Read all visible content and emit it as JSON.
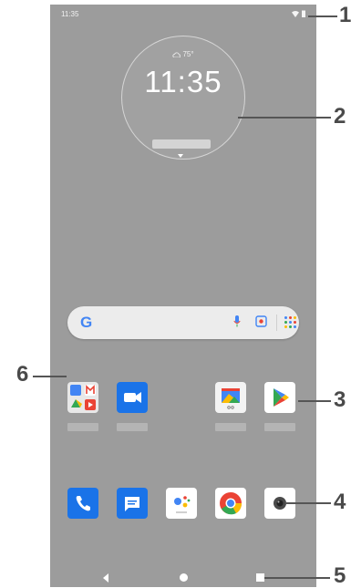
{
  "status_bar": {
    "time": "11:35"
  },
  "clock_widget": {
    "weather": "75°",
    "time": "11:35"
  },
  "search": {
    "logo": "G"
  },
  "colors": {
    "google_blue": "#4285F4",
    "google_red": "#EA4335",
    "google_yellow": "#FBBC05",
    "google_green": "#34A853",
    "wallpaper": "#9c9c9c"
  },
  "apps_row": [
    {
      "name": "google-apps-folder",
      "icon": "folder-icon"
    },
    {
      "name": "meet",
      "icon": "video-camera-icon"
    },
    {
      "name": "photos-frame",
      "icon": "photo-frame-icon"
    },
    {
      "name": "play-store",
      "icon": "play-store-icon"
    }
  ],
  "dock": [
    {
      "name": "phone",
      "icon": "phone-icon"
    },
    {
      "name": "messages",
      "icon": "messages-icon"
    },
    {
      "name": "assistant",
      "icon": "assistant-icon"
    },
    {
      "name": "chrome",
      "icon": "chrome-icon"
    },
    {
      "name": "camera",
      "icon": "camera-icon"
    }
  ],
  "callouts": [
    "1",
    "2",
    "3",
    "4",
    "5",
    "6"
  ]
}
